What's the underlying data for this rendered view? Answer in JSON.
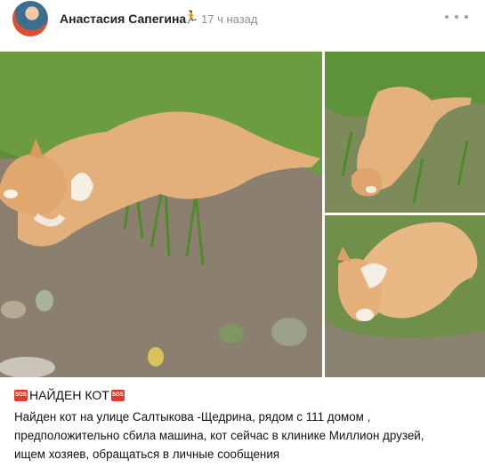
{
  "post": {
    "author": "Анастасия Сапегина",
    "author_emoji": "🏃",
    "time": "17 ч назад",
    "title": "НАЙДЕН КОТ",
    "sos_label": "SOS",
    "lines": [
      "Найден кот на улице Салтыкова -Щедрина, рядом с 111 домом ,",
      "предположительно сбила машина, кот сейчас в клинике Миллион друзей,",
      "ищем хозяев, обращаться в личные сообщения"
    ]
  },
  "colors": {
    "grass": "#5f8f35",
    "soil": "#8a7d6a",
    "cat_fur": "#e2b27e",
    "sos": "#e03a2f"
  }
}
